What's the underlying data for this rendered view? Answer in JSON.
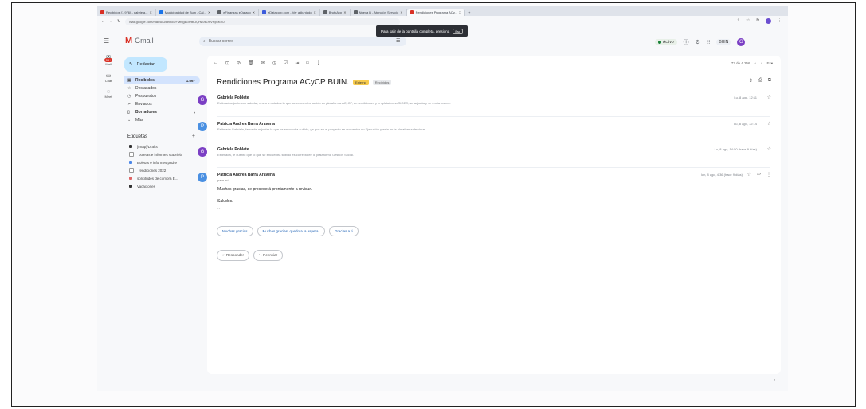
{
  "browser": {
    "tabs": [
      {
        "label": "Recibidos (1.976) - gabriela...",
        "color": "#d93025",
        "active": false
      },
      {
        "label": "Municipalidad de Buin - Cal...",
        "color": "#1a73e8",
        "active": false
      },
      {
        "label": "eFinanzas eDataco",
        "color": "#5f6368",
        "active": false
      },
      {
        "label": "eDatacorp.com - Ver adjuntado",
        "color": "#3b5bdb",
        "active": false
      },
      {
        "label": "BrutoAcp",
        "color": "#5f6368",
        "active": false
      },
      {
        "label": "Nueva B - Atención Servicio",
        "color": "#5f6368",
        "active": false
      },
      {
        "label": "Rendiciones Programa ACy...",
        "color": "#d93025",
        "active": true
      }
    ],
    "url": "mail.google.com/mail/u/0/#inbox/FMfcgzGtvtbOQnwJsLmVHpkKcfJ",
    "fullscreen_banner": {
      "text": "Para salir de la pantalla completa, presiona",
      "key": "Esc"
    }
  },
  "header": {
    "app_name": "Gmail",
    "search_placeholder": "Buscar correo",
    "status_label": "Activo",
    "org_label": "BUIN",
    "avatar_letter": "G"
  },
  "rail": {
    "items": [
      {
        "label": "Mail",
        "icon": "mail-icon",
        "badge": "99+"
      },
      {
        "label": "Chat",
        "icon": "chat-icon",
        "badge": ""
      },
      {
        "label": "Meet",
        "icon": "meet-icon",
        "badge": ""
      }
    ]
  },
  "sidebar": {
    "compose_label": "Redactar",
    "items": [
      {
        "label": "Recibidos",
        "icon": "inbox-icon",
        "count": "1.667",
        "active": true
      },
      {
        "label": "Destacados",
        "icon": "star-icon",
        "count": "",
        "active": false
      },
      {
        "label": "Pospuestos",
        "icon": "clock-icon",
        "count": "",
        "active": false
      },
      {
        "label": "Enviados",
        "icon": "send-icon",
        "count": "",
        "active": false
      },
      {
        "label": "Borradores",
        "icon": "draft-icon",
        "count": "",
        "active": false
      },
      {
        "label": "Más",
        "icon": "chevron-down-icon",
        "count": "",
        "active": false
      }
    ],
    "labels_heading": "Etiquetas",
    "labels": [
      {
        "label": "[Imap]/Drafts",
        "color": "#333333"
      },
      {
        "label": "boletas e informes Gabriela",
        "color": "#ffffff"
      },
      {
        "label": "Boletas e informes padre",
        "color": "#4a86e8"
      },
      {
        "label": "rendiciones 2022",
        "color": "#ffffff"
      },
      {
        "label": "solicitudes de compra E...",
        "color": "#e06666"
      },
      {
        "label": "Vacaciones",
        "color": "#333333"
      }
    ]
  },
  "thread": {
    "pager_text": "73 de 4.256",
    "subject": "Rendiciones Programa ACyCP BUIN.",
    "chips": [
      "Externo",
      "Recibidos"
    ],
    "messages": [
      {
        "sender": "Gabriela Poblete",
        "snippet": "Estimados junto con saludar, envío a ustedes lo que se encuentra subido en plataforma ACyCP, en rendiciones y en plataforma SIGEC, se adjunta y se envía correo.",
        "time": "Lu, 8 ago, 12:11",
        "avatar": "G",
        "color": "#7b3fc4"
      },
      {
        "sender": "Patricia Andrea Barra Aravena",
        "snippet": "Estimada Gabriela, favor de adjuntar lo que se encuentra subido, ya que en el proyecto se encuentra en Ejecución y esta en la plataforma de cierre.",
        "time": "Lu, 8 ago, 12:14",
        "avatar": "P",
        "color": "#4a90e2"
      },
      {
        "sender": "Gabriela Poblete",
        "snippet": "Estimada, te cuento que lo que se encuentra subido es correcto en la plataforma Gestión Social.",
        "time": "Lu, 8 ago, 14:50 (hace 9 días)",
        "avatar": "G",
        "color": "#7b3fc4"
      },
      {
        "sender": "Patricia Andrea Barra Aravena",
        "snippet": "",
        "time": "lun, 8 ago, 4:36 (hace 9 días)",
        "avatar": "P",
        "color": "#4a90e2",
        "to": "para mí"
      }
    ],
    "body": [
      "Muchas gracias, se procederá prontamente a revisar.",
      "Saludos.",
      "···"
    ],
    "smart_replies": [
      "Muchas gracias",
      "Muchas gracias, quedo a la espera.",
      "Gracias a ti"
    ],
    "reply_label": "Responder",
    "forward_label": "Reenviar"
  }
}
